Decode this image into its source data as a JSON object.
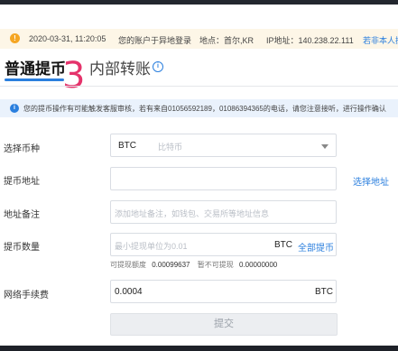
{
  "alert": {
    "datetime": "2020-03-31, 11:20:05",
    "message": "您的账户于异地登录",
    "location": "地点：首尔,KR",
    "ip": "IP地址：140.238.22.111",
    "action": "若非本人操"
  },
  "tabs": {
    "withdraw": "普通提币",
    "transfer": "内部转账",
    "annotation": "3"
  },
  "notice": "您的提币操作有可能触发客服审核，若有来自01056592189，01086394365的电话，请您注意接听，进行操作确认",
  "form": {
    "coin_label": "选择币种",
    "coin_value": "BTC",
    "coin_name": "比特币",
    "address_label": "提币地址",
    "address_link": "选择地址",
    "memo_label": "地址备注",
    "memo_placeholder": "添加地址备注，如钱包、交易所等地址信息",
    "amount_label": "提币数量",
    "amount_placeholder": "最小提现单位为0.01",
    "amount_unit": "BTC",
    "amount_all": "全部提币",
    "available_label": "可提现额度",
    "available_value": "0.00099637",
    "frozen_label": "暂不可提现",
    "frozen_value": "0.00000000",
    "fee_label": "网络手续费",
    "fee_value": "0.0004",
    "fee_unit": "BTC",
    "submit": "提交"
  }
}
